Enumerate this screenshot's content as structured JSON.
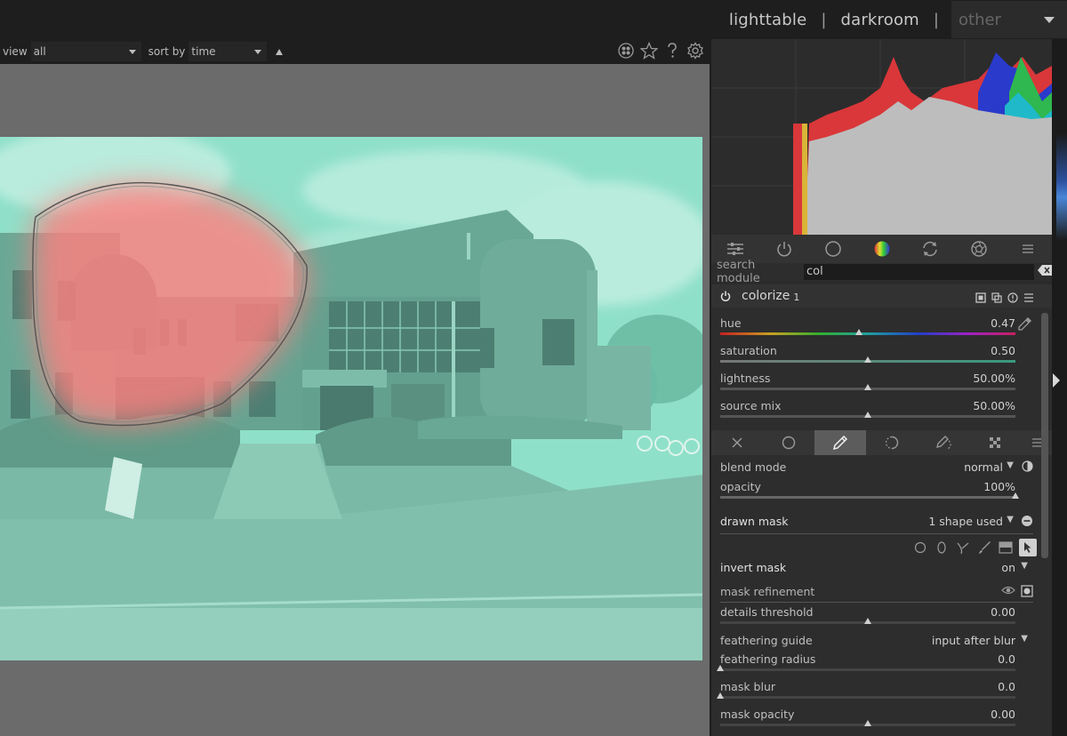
{
  "views": {
    "lighttable": "lighttable",
    "darkroom": "darkroom",
    "other": "other",
    "separator": "|"
  },
  "filterbar": {
    "view_label": "view",
    "view_value": "all",
    "sort_label": "sort by",
    "sort_value": "time",
    "icons": [
      "color-labels-icon",
      "star-icon",
      "help-icon",
      "gear-icon"
    ]
  },
  "panel": {
    "module_groups": [
      "sliders-icon",
      "power-icon",
      "circle-icon",
      "color-wheel-icon",
      "refresh-icon",
      "aperture-icon",
      "menu-icon"
    ],
    "search": {
      "label": "search module",
      "value": "col"
    },
    "module": {
      "name": "colorize",
      "instance": "1",
      "sliders": [
        {
          "name": "hue",
          "value": "0.47",
          "level": 0.47
        },
        {
          "name": "saturation",
          "value": "0.50",
          "level": 0.5
        },
        {
          "name": "lightness",
          "value": "50.00%",
          "level": 0.5
        },
        {
          "name": "source mix",
          "value": "50.00%",
          "level": 0.5
        }
      ],
      "blend_tabs": [
        "off-icon",
        "uniform-icon",
        "drawn-mask-icon",
        "parametric-icon",
        "drawn-parametric-icon",
        "raster-icon",
        "menu-icon"
      ],
      "blend_mode": {
        "label": "blend mode",
        "value": "normal"
      },
      "opacity": {
        "label": "opacity",
        "value": "100%",
        "level": 1.0
      },
      "drawn_mask": {
        "label": "drawn mask",
        "value": "1 shape used"
      },
      "invert_mask": {
        "label": "invert mask",
        "value": "on"
      },
      "mask_refinement": {
        "label": "mask refinement"
      },
      "details_threshold": {
        "label": "details threshold",
        "value": "0.00",
        "level": 0.5
      },
      "feathering_guide": {
        "label": "feathering guide",
        "value": "input after blur"
      },
      "feathering_radius": {
        "label": "feathering radius",
        "value": "0.0",
        "level": 0.0
      },
      "mask_blur": {
        "label": "mask blur",
        "value": "0.0",
        "level": 0.0
      },
      "mask_opacity": {
        "label": "mask opacity",
        "value": "0.00",
        "level": 0.5
      }
    }
  },
  "colors": {
    "photo_tint": "#8fe0c9",
    "mask_overlay": "#ff8080",
    "accent_slider": "#5c5c5c"
  }
}
